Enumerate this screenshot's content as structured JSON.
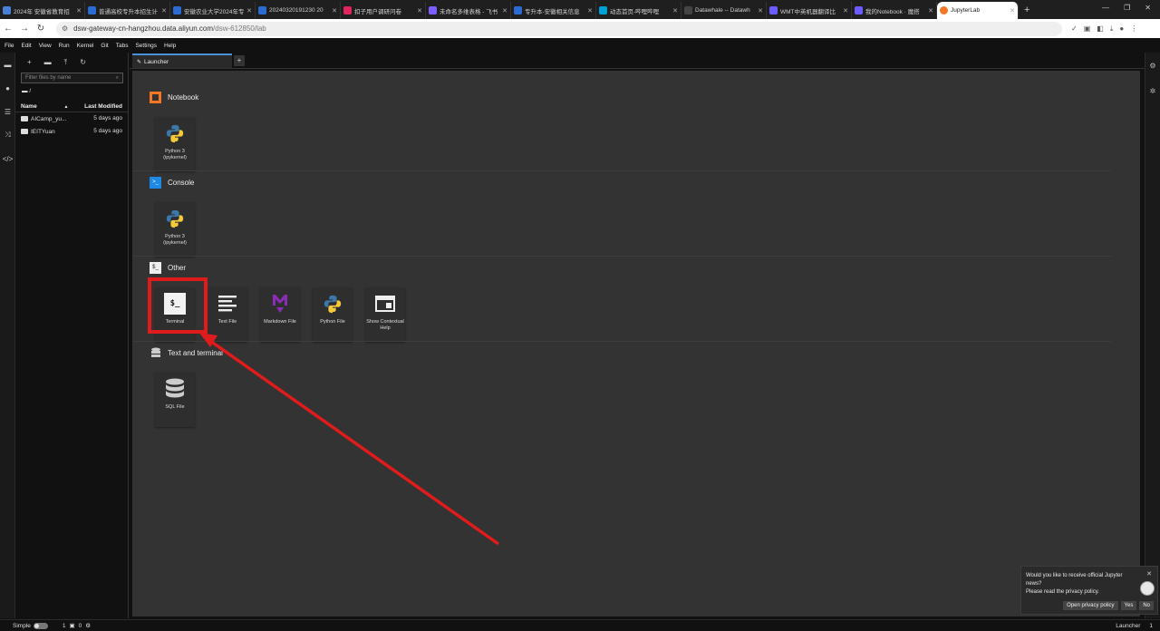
{
  "browser": {
    "tabs": [
      {
        "title": "2024年 安徽省教育招",
        "color": "#4a7fd6"
      },
      {
        "title": "普通高校专升本招生计",
        "color": "#2b6cd4"
      },
      {
        "title": "安徽农业大学2024年专",
        "color": "#2b6cd4"
      },
      {
        "title": "20240320191230 20",
        "color": "#2b6cd4"
      },
      {
        "title": "扣子用户调研问卷",
        "color": "#e0245e"
      },
      {
        "title": "未命名多维表格 - 飞书",
        "color": "#7b5cff"
      },
      {
        "title": "专升本-安徽相关信息",
        "color": "#2b6cd4"
      },
      {
        "title": "动态首页-哔哩哔哩",
        "color": "#00a1d6"
      },
      {
        "title": "Datawhale -- Datawh",
        "color": "#222222"
      },
      {
        "title": "WMT中英机器翻译比",
        "color": "#6b5cff"
      },
      {
        "title": "我的Notebook · 魔搭",
        "color": "#6b5cff"
      },
      {
        "title": "JupyterLab",
        "color": "#f37726"
      }
    ],
    "new_tab": "+",
    "url_host": "dsw-gateway-cn-hangzhou.data.aliyun.com",
    "url_path": "/dsw-612850/lab"
  },
  "menu": [
    "File",
    "Edit",
    "View",
    "Run",
    "Kernel",
    "Git",
    "Tabs",
    "Settings",
    "Help"
  ],
  "filebrowser": {
    "filter_placeholder": "Filter files by name",
    "path": "/",
    "col_name": "Name",
    "col_modified": "Last Modified",
    "sort_indicator": "▲",
    "rows": [
      {
        "name": "AICamp_yu...",
        "modified": "5 days ago"
      },
      {
        "name": "IEITYuan",
        "modified": "5 days ago"
      }
    ]
  },
  "tab": {
    "label": "Launcher",
    "add": "+"
  },
  "launcher": {
    "notebook": {
      "title": "Notebook",
      "cards": [
        {
          "label1": "Python 3",
          "label2": "(ipykernel)"
        }
      ]
    },
    "console": {
      "title": "Console",
      "cards": [
        {
          "label1": "Python 3",
          "label2": "(ipykernel)"
        }
      ]
    },
    "other": {
      "title": "Other",
      "cards": [
        {
          "label1": "Terminal",
          "label2": ""
        },
        {
          "label1": "Text File",
          "label2": ""
        },
        {
          "label1": "Markdown File",
          "label2": ""
        },
        {
          "label1": "Python File",
          "label2": ""
        },
        {
          "label1": "Show Contextual",
          "label2": "Help"
        }
      ]
    },
    "textterm": {
      "title": "Text and terminal",
      "cards": [
        {
          "label1": "SQL File",
          "label2": ""
        }
      ]
    }
  },
  "toast": {
    "line1": "Would you like to receive official Jupyter news?",
    "line2": "Please read the privacy policy.",
    "btn_policy": "Open privacy policy",
    "btn_yes": "Yes",
    "btn_no": "No",
    "close": "✕"
  },
  "status": {
    "mode": "Simple",
    "count1": "1",
    "count2": "0",
    "right_label": "Launcher",
    "right_count": "1"
  },
  "colors": {
    "highlight": "#e01b1b",
    "accent": "#4a90d9"
  }
}
